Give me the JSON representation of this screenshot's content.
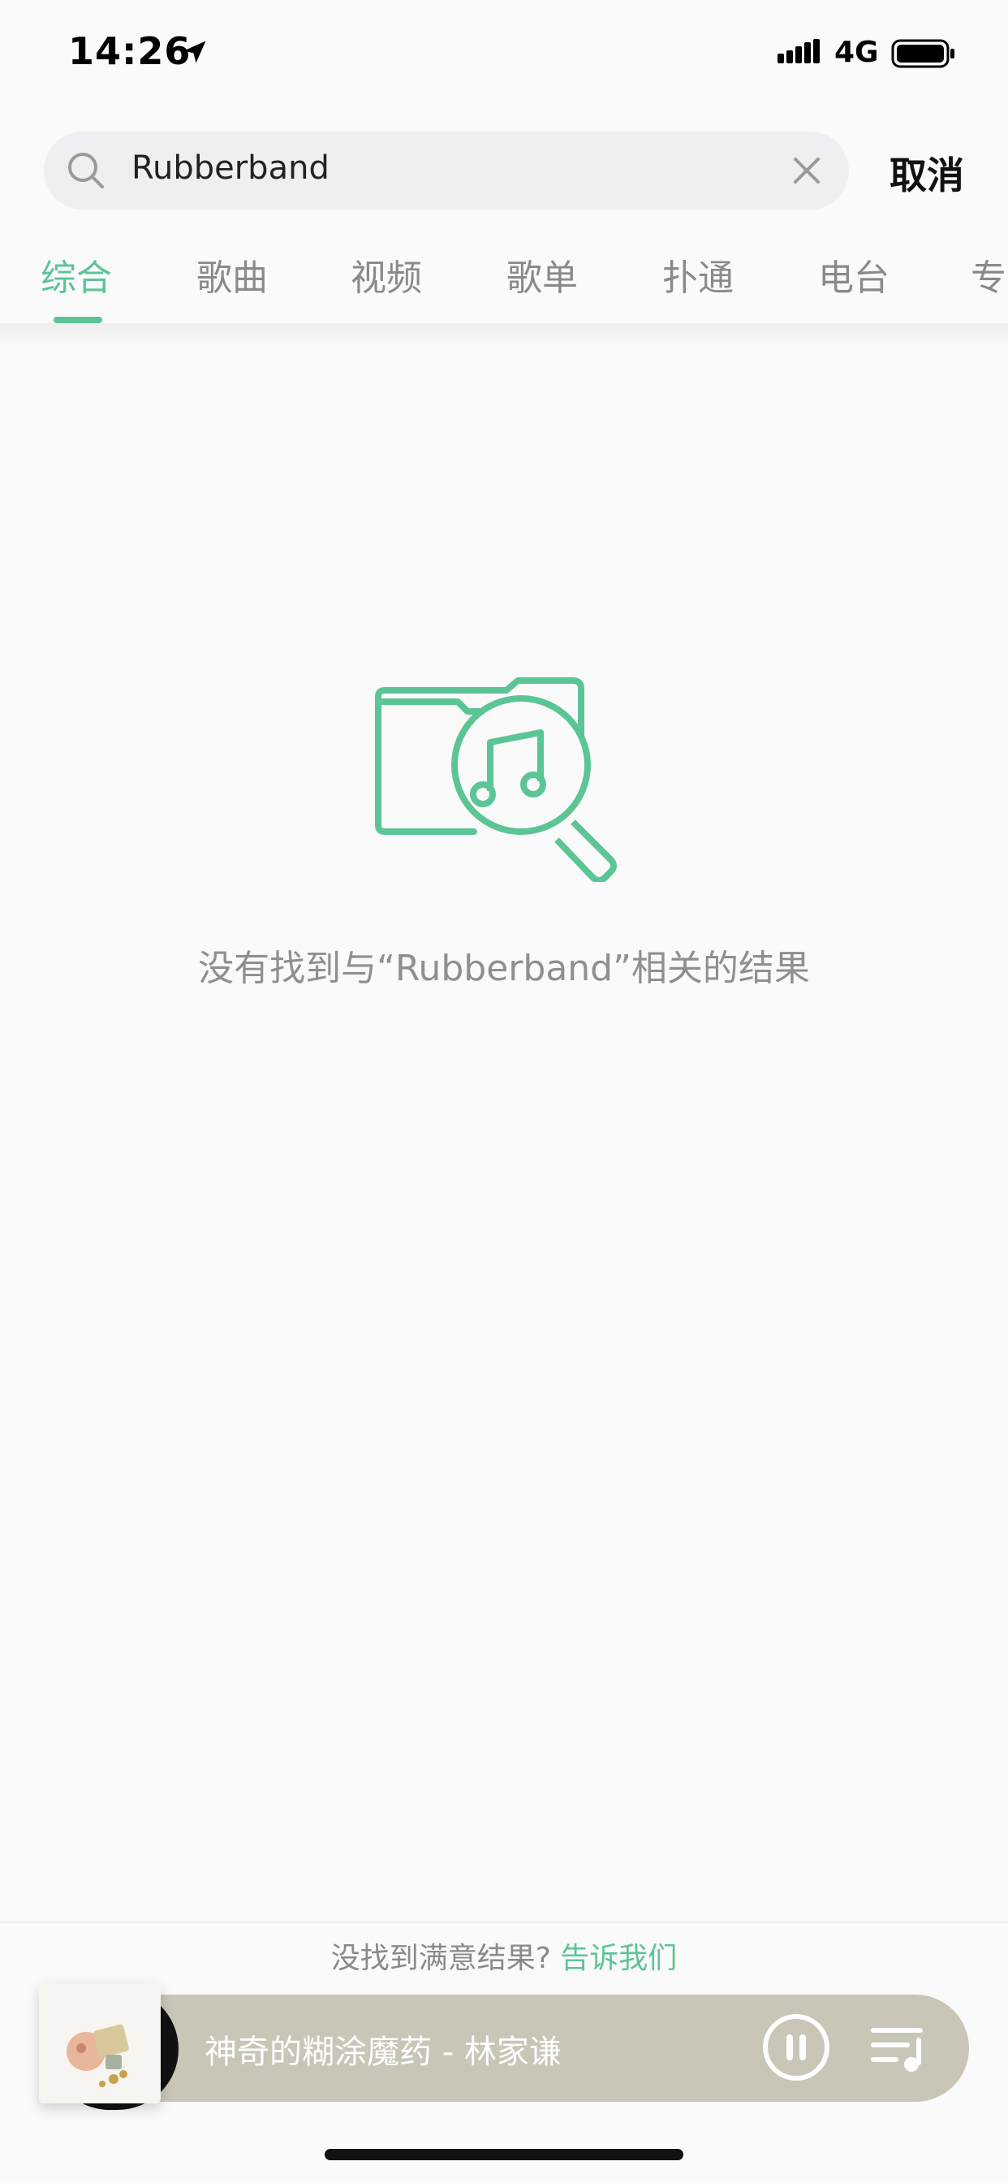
{
  "status_bar": {
    "time": "14:26",
    "network": "4G",
    "icons": [
      "location-arrow-icon",
      "signal-icon",
      "battery-icon"
    ]
  },
  "search": {
    "query": "Rubberband",
    "cancel_label": "取消"
  },
  "tabs": [
    {
      "label": "综合",
      "active": true
    },
    {
      "label": "歌曲",
      "active": false
    },
    {
      "label": "视频",
      "active": false
    },
    {
      "label": "歌单",
      "active": false
    },
    {
      "label": "扑通",
      "active": false
    },
    {
      "label": "电台",
      "active": false
    },
    {
      "label": "专",
      "active": false
    }
  ],
  "empty_state": {
    "message": "没有找到与“Rubberband”相关的结果",
    "icon": "music-folder-search-icon"
  },
  "feedback": {
    "prompt": "没找到满意结果?",
    "link": "告诉我们"
  },
  "player": {
    "now_playing": "神奇的糊涂魔药 - 林家谦",
    "icons": [
      "pause-icon",
      "playlist-icon"
    ]
  },
  "colors": {
    "accent": "#5cc596",
    "background": "#fafafa",
    "player_bar": "#c9c5b7",
    "search_bg": "#eeeff2"
  }
}
